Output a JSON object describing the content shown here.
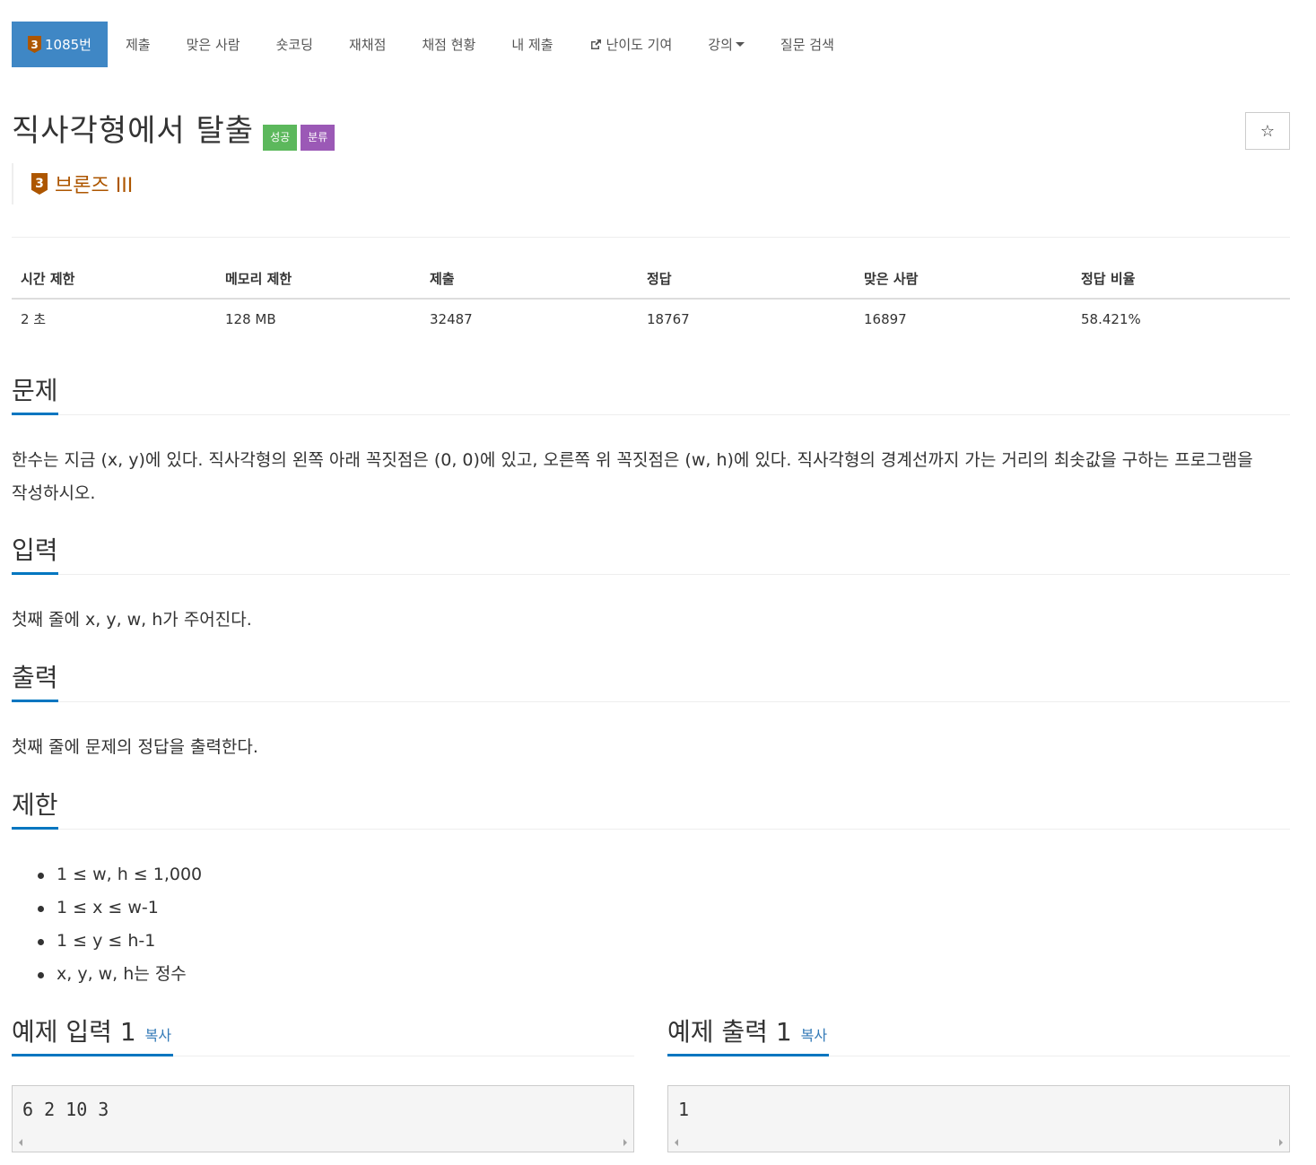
{
  "nav": {
    "problem": {
      "tier": "3",
      "label": "1085번"
    },
    "items": [
      "제출",
      "맞은 사람",
      "숏코딩",
      "재채점",
      "채점 현황",
      "내 제출",
      "난이도 기여",
      "강의",
      "질문 검색"
    ]
  },
  "problem": {
    "title": "직사각형에서 탈출",
    "labels": {
      "success": "성공",
      "category": "분류"
    },
    "star": "☆",
    "tier": {
      "number": "3",
      "name": "브론즈 III"
    }
  },
  "info": {
    "headers": [
      "시간 제한",
      "메모리 제한",
      "제출",
      "정답",
      "맞은 사람",
      "정답 비율"
    ],
    "values": [
      "2 초",
      "128 MB",
      "32487",
      "18767",
      "16897",
      "58.421%"
    ]
  },
  "sections": {
    "description": {
      "title": "문제",
      "line1": "한수는 지금 (x, y)에 있다. 직사각형의 왼쪽 아래 꼭짓점은 (0, 0)에 있고, 오른쪽 위 꼭짓점은 (w, h)에 있다. 직사각형의 경계선까지 가는 거리의 최솟값을 구하는 프로그램을",
      "line2": "작성하시오."
    },
    "input": {
      "title": "입력",
      "text": "첫째 줄에 x, y, w, h가 주어진다."
    },
    "output": {
      "title": "출력",
      "text": "첫째 줄에 문제의 정답을 출력한다."
    },
    "limits": {
      "title": "제한",
      "items": [
        "1 ≤ w, h ≤ 1,000",
        "1 ≤ x ≤ w-1",
        "1 ≤ y ≤ h-1",
        "x, y, w, h는 정수"
      ]
    }
  },
  "samples": {
    "input": {
      "title": "예제 입력 1",
      "copy": "복사",
      "content": "6 2 10 3"
    },
    "output": {
      "title": "예제 출력 1",
      "copy": "복사",
      "content": "1"
    }
  },
  "colors": {
    "nav_active": "#3f87c5",
    "tier_bronze": "#ad5600",
    "label_success": "#5cb85c",
    "label_category": "#9b59b6",
    "accent": "#0076c0"
  }
}
